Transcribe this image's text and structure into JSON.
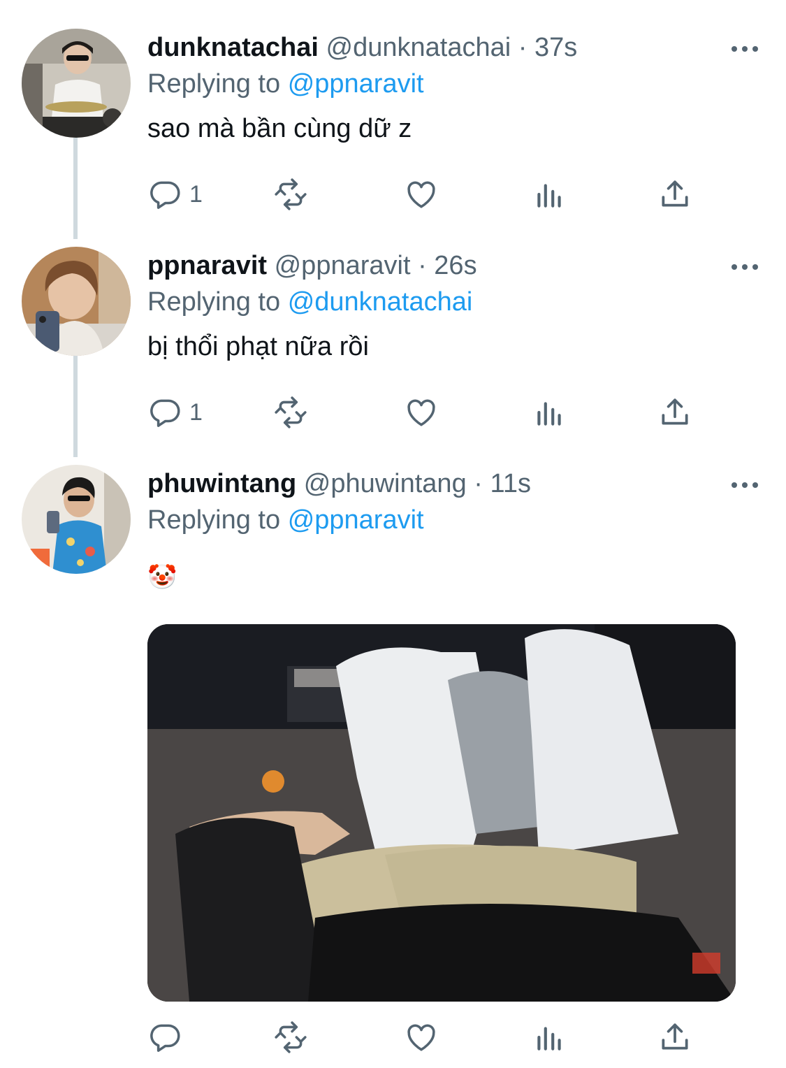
{
  "tweets": [
    {
      "name": "dunknatachai",
      "handle": "@dunknatachai",
      "time": "37s",
      "replying_label": "Replying to",
      "replying_to": "@ppnaravit",
      "text": "sao mà bần cùng dữ z",
      "reply_count": "1",
      "avatar_icon": "avatar-drummer"
    },
    {
      "name": "ppnaravit",
      "handle": "@ppnaravit",
      "time": "26s",
      "replying_label": "Replying to",
      "replying_to": "@dunknatachai",
      "text": "bị thổi phạt nữa rồi",
      "reply_count": "1",
      "avatar_icon": "avatar-selfie"
    },
    {
      "name": "phuwintang",
      "handle": "@phuwintang",
      "time": "11s",
      "replying_label": "Replying to",
      "replying_to": "@ppnaravit",
      "text": "🤡",
      "reply_count": "",
      "avatar_icon": "avatar-mirror-selfie",
      "media": "motorbike-photo"
    }
  ],
  "separator": "·",
  "colors": {
    "text": "#0f1419",
    "muted": "#536471",
    "accent": "#1d9bf0",
    "thread_line": "#cfd9de"
  },
  "icons": [
    "reply-icon",
    "retweet-icon",
    "like-icon",
    "analytics-icon",
    "share-icon",
    "more-icon"
  ]
}
